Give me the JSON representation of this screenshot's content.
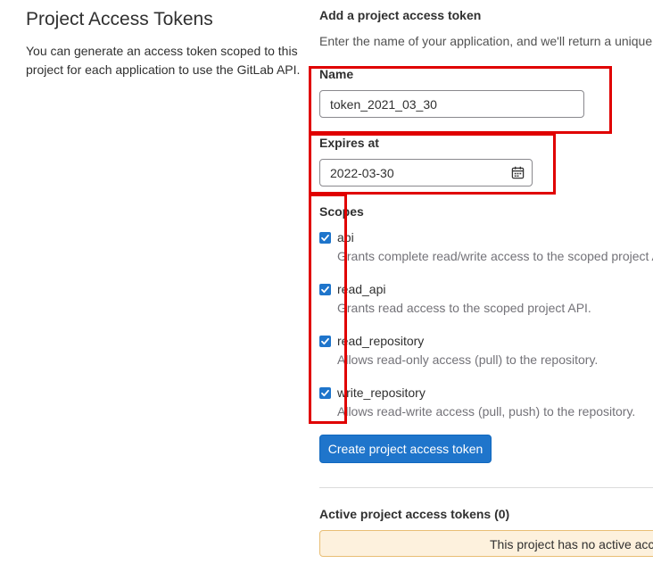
{
  "left": {
    "title": "Project Access Tokens",
    "description": "You can generate an access token scoped to this project for each application to use the GitLab API."
  },
  "form": {
    "heading": "Add a project access token",
    "help_text": "Enter the name of your application, and we'll return a unique",
    "name_label": "Name",
    "name_value": "token_2021_03_30",
    "expires_label": "Expires at",
    "expires_value": "2022-03-30",
    "scopes_label": "Scopes",
    "scopes": [
      {
        "name": "api",
        "checked": true,
        "description": "Grants complete read/write access to the scoped project A"
      },
      {
        "name": "read_api",
        "checked": true,
        "description": "Grants read access to the scoped project API."
      },
      {
        "name": "read_repository",
        "checked": true,
        "description": "Allows read-only access (pull) to the repository."
      },
      {
        "name": "write_repository",
        "checked": true,
        "description": "Allows read-write access (pull, push) to the repository."
      }
    ],
    "submit_label": "Create project access token"
  },
  "active": {
    "heading": "Active project access tokens (0)",
    "empty_notice": "This project has no active acce"
  },
  "icons": {
    "calendar": "calendar-icon",
    "checkbox": "checkmark-icon"
  },
  "colors": {
    "primary": "#1f75cb",
    "annotation": "#e00000",
    "notice_bg": "#fdf1dd"
  }
}
